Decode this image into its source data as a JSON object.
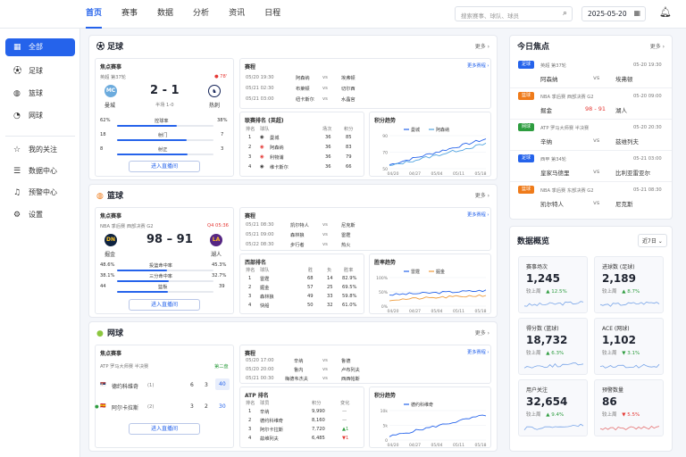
{
  "nav": {
    "items": [
      "首页",
      "赛事",
      "数据",
      "分析",
      "资讯",
      "日程"
    ],
    "search_placeholder": "搜索赛事、球队、球员",
    "date": "2025-05-20"
  },
  "sidebar": {
    "items": [
      "全部",
      "足球",
      "篮球",
      "网球"
    ],
    "items2": [
      "我的关注",
      "数据中心",
      "预警中心",
      "设置"
    ]
  },
  "football": {
    "title": "足球",
    "more": "更多 ›",
    "focus_label": "焦点赛事",
    "league": "英超 第37轮",
    "live": "● 78'",
    "home": "曼城",
    "away": "热刺",
    "score": "2 - 1",
    "half": "半场 1-0",
    "stats": [
      {
        "l": "62%",
        "name": "控球率",
        "r": "38%",
        "p": 0.62
      },
      {
        "l": "18",
        "name": "射门",
        "r": "7",
        "p": 0.72
      },
      {
        "l": "8",
        "name": "射正",
        "r": "3",
        "p": 0.73
      }
    ],
    "live_btn": "进入直播间",
    "schedule_label": "赛程",
    "schedule_more": "更多赛程 ›",
    "schedule": [
      {
        "t": "05/20 19:30",
        "h": "阿森纳",
        "vs": "vs",
        "a": "埃弗顿"
      },
      {
        "t": "05/21 02:30",
        "h": "布莱顿",
        "vs": "vs",
        "a": "切尔西"
      },
      {
        "t": "05/21 03:00",
        "h": "纽卡斯尔",
        "vs": "vs",
        "a": "水晶宫"
      }
    ],
    "standings_label": "联赛排名 (英超)",
    "standings_cols": [
      "排名",
      "球队",
      "场次",
      "积分"
    ],
    "standings": [
      {
        "r": "1",
        "n": "曼城",
        "g": "36",
        "p": "85"
      },
      {
        "r": "2",
        "n": "阿森纳",
        "g": "36",
        "p": "83"
      },
      {
        "r": "3",
        "n": "利物浦",
        "g": "36",
        "p": "79"
      },
      {
        "r": "4",
        "n": "维卡斯尔",
        "g": "36",
        "p": "66"
      }
    ],
    "trend_label": "积分趋势",
    "legend": [
      "曼城",
      "阿森纳"
    ],
    "yticks": [
      "90",
      "70",
      "50"
    ],
    "xticks": [
      "04/20",
      "04/27",
      "05/04",
      "05/11",
      "05/18"
    ]
  },
  "basketball": {
    "title": "篮球",
    "more": "更多 ›",
    "focus_label": "焦点赛事",
    "league": "NBA 季后赛 西部决赛 G2",
    "live": "Q4 05:36",
    "home": "掘金",
    "away": "湖人",
    "score": "98 – 91",
    "stats": [
      {
        "l": "48.6%",
        "name": "投篮命中率",
        "r": "45.3%",
        "p": 0.52
      },
      {
        "l": "38.1%",
        "name": "三分命中率",
        "r": "32.7%",
        "p": 0.54
      },
      {
        "l": "44",
        "name": "篮板",
        "r": "39",
        "p": 0.53
      }
    ],
    "live_btn": "进入直播间",
    "schedule_label": "赛程",
    "schedule_more": "更多赛程 ›",
    "schedule": [
      {
        "t": "05/21 08:30",
        "h": "凯尔特人",
        "vs": "vs",
        "a": "尼克斯"
      },
      {
        "t": "05/21 09:00",
        "h": "森林狼",
        "vs": "vs",
        "a": "雷霆"
      },
      {
        "t": "05/22 08:30",
        "h": "步行者",
        "vs": "vs",
        "a": "热火"
      }
    ],
    "standings_label": "西部排名",
    "standings_cols": [
      "排名",
      "球队",
      "胜",
      "负",
      "胜率"
    ],
    "standings": [
      {
        "r": "1",
        "n": "雷霆",
        "w": "68",
        "l": "14",
        "p": "82.9%"
      },
      {
        "r": "2",
        "n": "掘金",
        "w": "57",
        "l": "25",
        "p": "69.5%"
      },
      {
        "r": "3",
        "n": "森林狼",
        "w": "49",
        "l": "33",
        "p": "59.8%"
      },
      {
        "r": "4",
        "n": "快船",
        "w": "50",
        "l": "32",
        "p": "61.0%"
      }
    ],
    "trend_label": "胜率趋势",
    "legend": [
      "雷霆",
      "掘金"
    ],
    "yticks": [
      "100%",
      "50%",
      "0%"
    ],
    "xticks": [
      "04/20",
      "04/27",
      "05/04",
      "05/11",
      "05/18"
    ]
  },
  "tennis": {
    "title": "网球",
    "more": "更多 ›",
    "focus_label": "焦点赛事",
    "league": "ATP 罗马大师赛 半决赛",
    "set": "第二盘",
    "players": [
      {
        "name": "德约科维奇",
        "seed": "(1)",
        "s1": "6",
        "s2": "3",
        "pts": "40"
      },
      {
        "name": "阿尔卡拉斯",
        "seed": "(2)",
        "s1": "3",
        "s2": "2",
        "pts": "30"
      }
    ],
    "live_btn": "进入直播间",
    "schedule_label": "赛程",
    "schedule_more": "更多赛程 ›",
    "schedule": [
      {
        "t": "05/20 17:00",
        "h": "辛纳",
        "vs": "vs",
        "a": "鲁德"
      },
      {
        "t": "05/20 20:00",
        "h": "鲁内",
        "vs": "vs",
        "a": "卢布列夫"
      },
      {
        "t": "05/21 00:30",
        "h": "梅德韦杰夫",
        "vs": "vs",
        "a": "西西帕斯"
      }
    ],
    "standings_label": "ATP 排名",
    "standings_cols": [
      "排名",
      "球员",
      "积分",
      "变化"
    ],
    "standings": [
      {
        "r": "1",
        "n": "辛纳",
        "p": "9,990",
        "c": "—"
      },
      {
        "r": "2",
        "n": "德约科维奇",
        "p": "8,160",
        "c": "—"
      },
      {
        "r": "3",
        "n": "阿尔卡拉斯",
        "p": "7,720",
        "c": "▲1"
      },
      {
        "r": "4",
        "n": "兹维列夫",
        "p": "6,485",
        "c": "▼1"
      }
    ],
    "trend_label": "积分趋势",
    "legend": [
      "德约科维奇"
    ],
    "yticks": [
      "10k",
      "5k",
      "0"
    ],
    "xticks": [
      "04/20",
      "04/27",
      "05/04",
      "05/11",
      "05/18"
    ]
  },
  "today": {
    "title": "今日焦点",
    "more": "更多 ›",
    "items": [
      {
        "tag": "足球",
        "color": "#2563eb",
        "league": "英超 第37轮",
        "time": "05-20 19:30",
        "h": "阿森纳",
        "mid": "vs",
        "a": "埃弗顿"
      },
      {
        "tag": "篮球",
        "color": "#ef7b1a",
        "league": "NBA 季后赛 西部决赛 G2",
        "time": "05-20 09:00",
        "h": "掘金",
        "mid": "98 - 91",
        "a": "湖人"
      },
      {
        "tag": "网球",
        "color": "#2e9d3f",
        "league": "ATP 罗马大师赛 半决赛",
        "time": "05-20 20:30",
        "h": "辛纳",
        "mid": "vs",
        "a": "兹维列夫"
      },
      {
        "tag": "足球",
        "color": "#2563eb",
        "league": "西甲 第34轮",
        "time": "05-21 03:00",
        "h": "皇家马德里",
        "mid": "vs",
        "a": "比利亚雷亚尔"
      },
      {
        "tag": "篮球",
        "color": "#ef7b1a",
        "league": "NBA 季后赛 东部决赛 G2",
        "time": "05-21 08:30",
        "h": "凯尔特人",
        "mid": "vs",
        "a": "尼克斯"
      }
    ]
  },
  "overview": {
    "title": "数据概览",
    "period": "近7日 ⌄",
    "cards": [
      {
        "label": "赛事场次",
        "value": "1,245",
        "cmp": "较上周",
        "chg": "▲ 12.5%",
        "color": "#2e9d3f"
      },
      {
        "label": "进球数 (足球)",
        "value": "2,189",
        "cmp": "较上周",
        "chg": "▲ 8.7%",
        "color": "#2e9d3f"
      },
      {
        "label": "得分数 (篮球)",
        "value": "18,732",
        "cmp": "较上周",
        "chg": "▲ 6.3%",
        "color": "#2e9d3f"
      },
      {
        "label": "ACE (网球)",
        "value": "1,102",
        "cmp": "较上周",
        "chg": "▼ 3.1%",
        "color": "#2e9d3f"
      },
      {
        "label": "用户关注",
        "value": "32,654",
        "cmp": "较上周",
        "chg": "▲ 9.4%",
        "color": "#2e9d3f"
      },
      {
        "label": "预警数量",
        "value": "86",
        "cmp": "较上周",
        "chg": "▼ 5.5%",
        "color": "#e53935"
      }
    ]
  }
}
